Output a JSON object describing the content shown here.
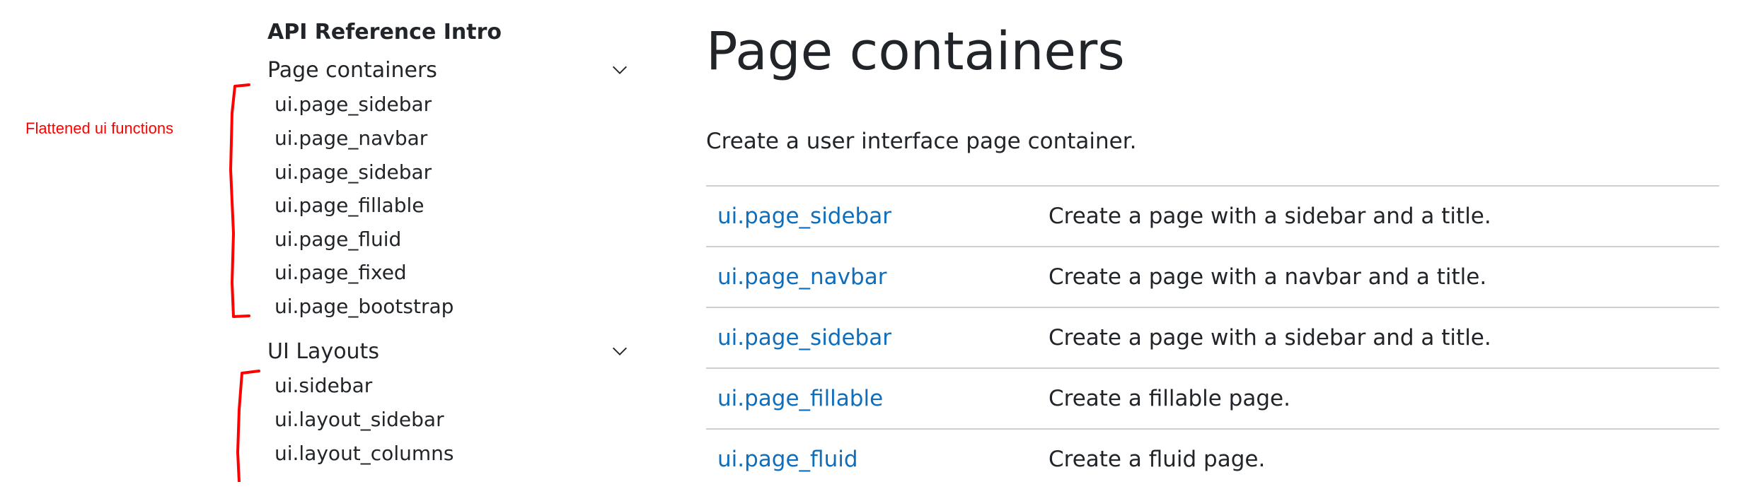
{
  "annotation": {
    "label": "Flattened ui functions",
    "color": "#ff0000"
  },
  "sidebar": {
    "intro": "API Reference Intro",
    "sections": [
      {
        "title": "Page containers",
        "icon": "chevron-down-icon",
        "items": [
          "ui.page_sidebar",
          "ui.page_navbar",
          "ui.page_sidebar",
          "ui.page_fillable",
          "ui.page_fluid",
          "ui.page_fixed",
          "ui.page_bootstrap"
        ]
      },
      {
        "title": "UI Layouts",
        "icon": "chevron-down-icon",
        "items": [
          "ui.sidebar",
          "ui.layout_sidebar",
          "ui.layout_columns"
        ]
      }
    ]
  },
  "main": {
    "title": "Page containers",
    "description": "Create a user interface page container.",
    "table": [
      {
        "name": "ui.page_sidebar",
        "description": "Create a page with a sidebar and a title."
      },
      {
        "name": "ui.page_navbar",
        "description": "Create a page with a navbar and a title."
      },
      {
        "name": "ui.page_sidebar",
        "description": "Create a page with a sidebar and a title."
      },
      {
        "name": "ui.page_fillable",
        "description": "Create a fillable page."
      },
      {
        "name": "ui.page_fluid",
        "description": "Create a fluid page."
      }
    ]
  },
  "colors": {
    "link": "#0d6ebd",
    "text": "#212529",
    "divider": "#cfcfcf",
    "annotation": "#ff0000"
  }
}
